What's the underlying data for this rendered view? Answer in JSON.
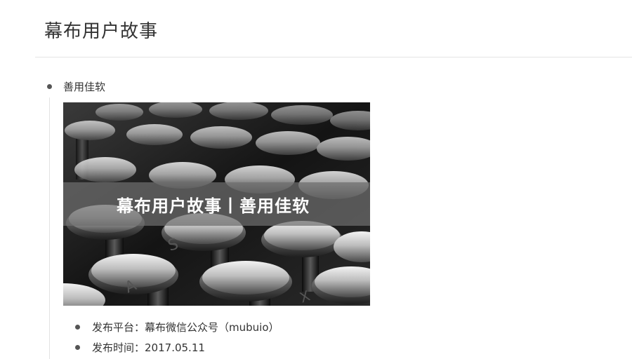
{
  "page": {
    "title": "幕布用户故事"
  },
  "outline": {
    "top_node": {
      "label": "善用佳软"
    },
    "cover_image": {
      "overlay_text": "幕布用户故事丨善用佳软"
    },
    "children": [
      {
        "label": "发布平台：",
        "value": "幕布微信公众号（mubuio）"
      },
      {
        "label": "发布时间：",
        "value": "2017.05.11"
      }
    ]
  }
}
